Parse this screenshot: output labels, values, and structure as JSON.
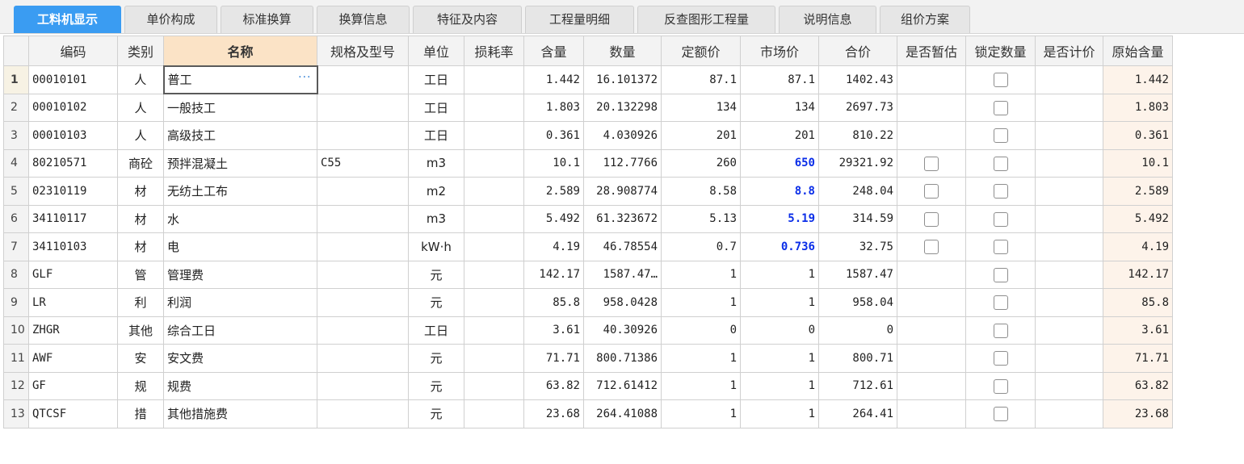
{
  "tabs": [
    {
      "label": "工料机显示",
      "active": true
    },
    {
      "label": "单价构成"
    },
    {
      "label": "标准换算"
    },
    {
      "label": "换算信息"
    },
    {
      "label": "特征及内容"
    },
    {
      "label": "工程量明细"
    },
    {
      "label": "反查图形工程量"
    },
    {
      "label": "说明信息"
    },
    {
      "label": "组价方案"
    }
  ],
  "columns": [
    "编码",
    "类别",
    "名称",
    "规格及型号",
    "单位",
    "损耗率",
    "含量",
    "数量",
    "定额价",
    "市场价",
    "合价",
    "是否暂估",
    "锁定数量",
    "是否计价",
    "原始含量"
  ],
  "rows": [
    {
      "n": "1",
      "code": "00010101",
      "cat": "人",
      "name": "普工",
      "spec": "",
      "unit": "工日",
      "loss": "",
      "qty": "1.442",
      "amount": "16.101372",
      "quota": "87.1",
      "market": "87.1",
      "total": "1402.43",
      "orig": "1.442"
    },
    {
      "n": "2",
      "code": "00010102",
      "cat": "人",
      "name": "一般技工",
      "spec": "",
      "unit": "工日",
      "loss": "",
      "qty": "1.803",
      "amount": "20.132298",
      "quota": "134",
      "market": "134",
      "total": "2697.73",
      "orig": "1.803"
    },
    {
      "n": "3",
      "code": "00010103",
      "cat": "人",
      "name": "高级技工",
      "spec": "",
      "unit": "工日",
      "loss": "",
      "qty": "0.361",
      "amount": "4.030926",
      "quota": "201",
      "market": "201",
      "total": "810.22",
      "orig": "0.361"
    },
    {
      "n": "4",
      "code": "80210571",
      "cat": "商砼",
      "name": "预拌混凝土",
      "spec": "C55",
      "unit": "m3",
      "loss": "",
      "qty": "10.1",
      "amount": "112.7766",
      "quota": "260",
      "market": "650",
      "total": "29321.92",
      "orig": "10.1"
    },
    {
      "n": "5",
      "code": "02310119",
      "cat": "材",
      "name": "无纺土工布",
      "spec": "",
      "unit": "m2",
      "loss": "",
      "qty": "2.589",
      "amount": "28.908774",
      "quota": "8.58",
      "market": "8.8",
      "total": "248.04",
      "orig": "2.589"
    },
    {
      "n": "6",
      "code": "34110117",
      "cat": "材",
      "name": "水",
      "spec": "",
      "unit": "m3",
      "loss": "",
      "qty": "5.492",
      "amount": "61.323672",
      "quota": "5.13",
      "market": "5.19",
      "total": "314.59",
      "orig": "5.492"
    },
    {
      "n": "7",
      "code": "34110103",
      "cat": "材",
      "name": "电",
      "spec": "",
      "unit": "kW·h",
      "loss": "",
      "qty": "4.19",
      "amount": "46.78554",
      "quota": "0.7",
      "market": "0.736",
      "total": "32.75",
      "orig": "4.19"
    },
    {
      "n": "8",
      "code": "GLF",
      "cat": "管",
      "name": "管理费",
      "spec": "",
      "unit": "元",
      "loss": "",
      "qty": "142.17",
      "amount": "1587.47…",
      "quota": "1",
      "market": "1",
      "total": "1587.47",
      "orig": "142.17"
    },
    {
      "n": "9",
      "code": "LR",
      "cat": "利",
      "name": "利润",
      "spec": "",
      "unit": "元",
      "loss": "",
      "qty": "85.8",
      "amount": "958.0428",
      "quota": "1",
      "market": "1",
      "total": "958.04",
      "orig": "85.8"
    },
    {
      "n": "10",
      "code": "ZHGR",
      "cat": "其他",
      "name": "综合工日",
      "spec": "",
      "unit": "工日",
      "loss": "",
      "qty": "3.61",
      "amount": "40.30926",
      "quota": "0",
      "market": "0",
      "total": "0",
      "orig": "3.61"
    },
    {
      "n": "11",
      "code": "AWF",
      "cat": "安",
      "name": "安文费",
      "spec": "",
      "unit": "元",
      "loss": "",
      "qty": "71.71",
      "amount": "800.71386",
      "quota": "1",
      "market": "1",
      "total": "800.71",
      "orig": "71.71"
    },
    {
      "n": "12",
      "code": "GF",
      "cat": "规",
      "name": "规费",
      "spec": "",
      "unit": "元",
      "loss": "",
      "qty": "63.82",
      "amount": "712.61412",
      "quota": "1",
      "market": "1",
      "total": "712.61",
      "orig": "63.82"
    },
    {
      "n": "13",
      "code": "QTCSF",
      "cat": "措",
      "name": "其他措施费",
      "spec": "",
      "unit": "元",
      "loss": "",
      "qty": "23.68",
      "amount": "264.41088",
      "quota": "1",
      "market": "1",
      "total": "264.41",
      "orig": "23.68"
    }
  ],
  "ellipsis_button": "···",
  "colors": {
    "active_tab": "#3a9cf2",
    "market_modified": "#0b2ee8",
    "name_header": "#fbe3c6",
    "orig_col": "#fdf3ea"
  }
}
